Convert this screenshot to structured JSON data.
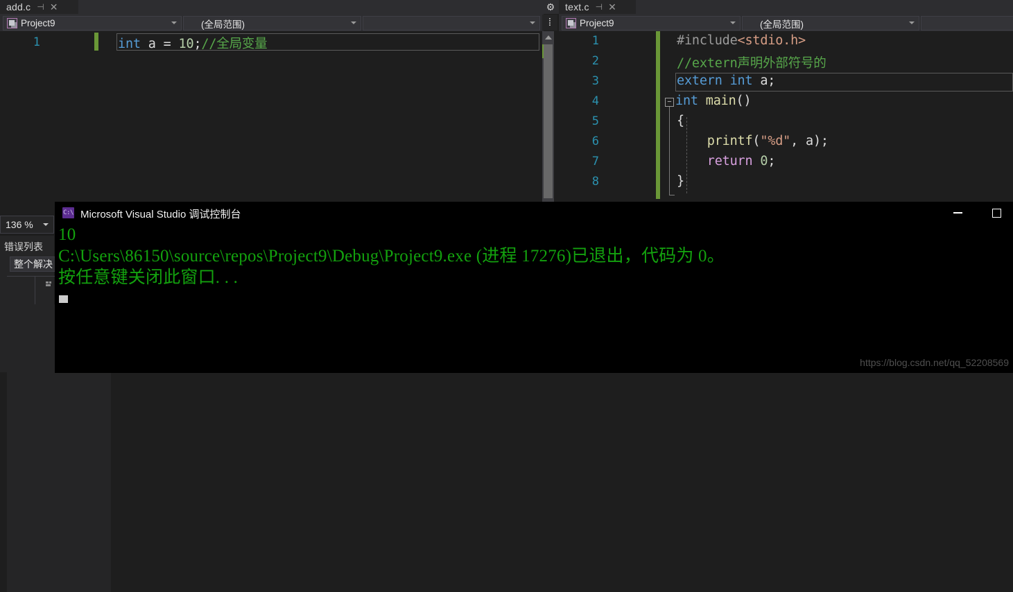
{
  "ide": {
    "tabs": [
      {
        "name": "add.c",
        "pin": "⊣",
        "close": "✕"
      },
      {
        "name": "text.c",
        "pin": "⊣",
        "close": "✕"
      }
    ],
    "gear_icon": "gear-icon",
    "left_nav": {
      "project": "Project9",
      "scope": "(全局范围)",
      "member": ""
    },
    "right_nav": {
      "project": "Project9",
      "scope": "(全局范围)",
      "member": ""
    },
    "splitter_icon": "split-horizontal-icon",
    "left_editor": {
      "line_numbers": [
        "1"
      ],
      "code": [
        {
          "n": "1",
          "tokens": [
            {
              "t": "int",
              "c": "kw"
            },
            {
              "t": " a ",
              "c": "id"
            },
            {
              "t": "= ",
              "c": "pun"
            },
            {
              "t": "10",
              "c": "num"
            },
            {
              "t": ";",
              "c": "pun"
            },
            {
              "t": "//全局变量",
              "c": "cmt"
            }
          ]
        }
      ]
    },
    "right_editor": {
      "line_numbers": [
        "1",
        "2",
        "3",
        "4",
        "5",
        "6",
        "7",
        "8"
      ],
      "code": [
        {
          "n": "1",
          "tokens": [
            {
              "t": "#include",
              "c": "pp"
            },
            {
              "t": "<stdio.h>",
              "c": "inc"
            }
          ]
        },
        {
          "n": "2",
          "tokens": [
            {
              "t": "//extern声明外部符号的",
              "c": "cmt"
            }
          ]
        },
        {
          "n": "3",
          "tokens": [
            {
              "t": "extern int",
              "c": "kw"
            },
            {
              "t": " a;",
              "c": "id"
            }
          ]
        },
        {
          "n": "4",
          "tokens": [
            {
              "t": "int",
              "c": "kw"
            },
            {
              "t": " ",
              "c": "id"
            },
            {
              "t": "main",
              "c": "fn"
            },
            {
              "t": "()",
              "c": "pun"
            }
          ]
        },
        {
          "n": "5",
          "tokens": [
            {
              "t": "{",
              "c": "pun"
            }
          ]
        },
        {
          "n": "6",
          "tokens": [
            {
              "t": "    ",
              "c": "pun"
            },
            {
              "t": "printf",
              "c": "fn"
            },
            {
              "t": "(",
              "c": "pun"
            },
            {
              "t": "\"%d\"",
              "c": "str"
            },
            {
              "t": ", a)",
              "c": "pun"
            },
            {
              "t": ";",
              "c": "pun"
            }
          ]
        },
        {
          "n": "7",
          "tokens": [
            {
              "t": "    ",
              "c": "pun"
            },
            {
              "t": "return",
              "c": "kw2"
            },
            {
              "t": " ",
              "c": "id"
            },
            {
              "t": "0",
              "c": "num"
            },
            {
              "t": ";",
              "c": "pun"
            }
          ]
        },
        {
          "n": "8",
          "tokens": [
            {
              "t": "}",
              "c": "pun"
            }
          ]
        }
      ]
    },
    "zoom_level": "136 %",
    "error_list": {
      "title": "错误列表",
      "filter": "整个解决",
      "header_icon": "sort-icon"
    }
  },
  "console": {
    "icon_text": "C:\\",
    "title": "Microsoft Visual Studio 调试控制台",
    "minimize_icon": "minimize-icon",
    "maximize_icon": "maximize-icon",
    "lines": [
      "10",
      "C:\\Users\\86150\\source\\repos\\Project9\\Debug\\Project9.exe (进程 17276)已退出，代码为 0。",
      "按任意键关闭此窗口. . ."
    ]
  },
  "watermark": "https://blog.csdn.net/qq_52208569",
  "colors": {
    "ide_bg": "#1e1e1e",
    "chrome_bg": "#2d2d30",
    "console_text": "#13a10e",
    "linenum": "#2b91af",
    "comment": "#57a64a",
    "keyword": "#569cd6",
    "changebar": "#6a9737"
  }
}
